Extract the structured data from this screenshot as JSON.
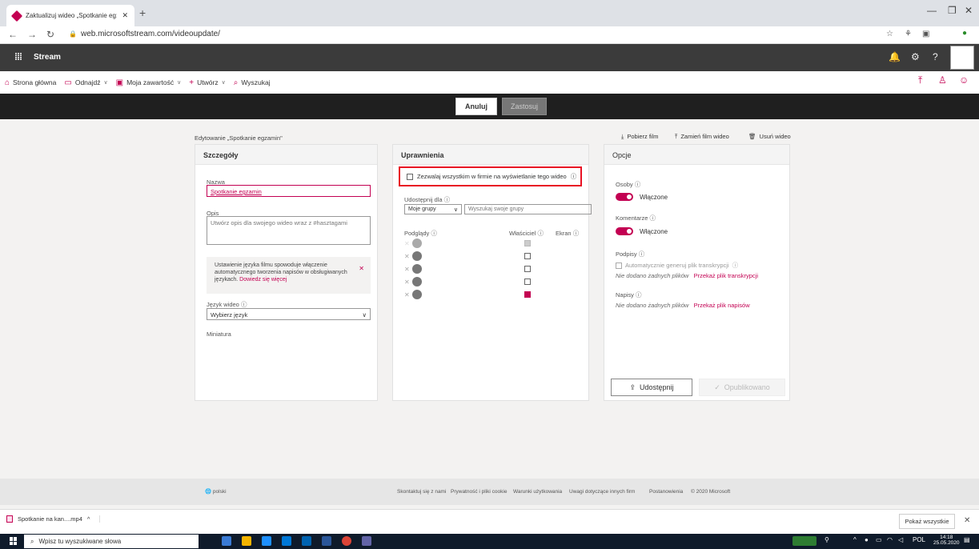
{
  "browser": {
    "tab_title": "Zaktualizuj wideo „Spotkanie eg:",
    "tab_close": "✕",
    "new_tab": "+",
    "url": "web.microsoftstream.com/videoupdate/"
  },
  "header": {
    "brand": "Stream",
    "help": "?"
  },
  "nav": {
    "items": [
      {
        "label": "Strona główna",
        "icon": "home-icon"
      },
      {
        "label": "Odnajdź",
        "icon": "discover-icon"
      },
      {
        "label": "Moja zawartość",
        "icon": "content-icon"
      },
      {
        "label": "Utwórz",
        "icon": "plus-icon"
      },
      {
        "label": "Wyszukaj",
        "icon": "search-icon"
      }
    ]
  },
  "actionbar": {
    "cancel": "Anuluj",
    "apply": "Zastosuj"
  },
  "editing_title": "Edytowanie „Spotkanie egzamin\"",
  "top_actions": {
    "download": "Pobierz film",
    "replace": "Zamień film wideo",
    "delete": "Usuń wideo"
  },
  "details": {
    "title": "Szczegóły",
    "name_label": "Nazwa",
    "name_value": "Spotkanie egzamin",
    "desc_label": "Opis",
    "desc_placeholder": "Utwórz opis dla swojego wideo wraz z #hasztagami",
    "lang_notice": "Ustawienie języka filmu spowoduje włączenie automatycznego tworzenia napisów w obsługiwanych językach.",
    "lang_notice_link": "Dowiedz się więcej",
    "lang_label": "Język wideo",
    "lang_value": "Wybierz język",
    "thumb_label": "Miniatura"
  },
  "permissions": {
    "title": "Uprawnienia",
    "allow_all": "Zezwalaj wszystkim w firmie na wyświetlanie tego wideo",
    "share_label": "Udostępnij dla",
    "share_select": "Moje grupy",
    "share_search_placeholder": "Wyszukaj swoje grupy",
    "col_viewers": "Podglądy",
    "col_owner": "Właściciel",
    "col_screen": "Ekran",
    "rows": [
      {
        "owner": "disabled"
      },
      {
        "owner": "unchecked"
      },
      {
        "owner": "unchecked"
      },
      {
        "owner": "unchecked"
      },
      {
        "owner": "checked"
      }
    ]
  },
  "options": {
    "title": "Opcje",
    "people_label": "Osoby",
    "people_state": "Włączone",
    "comments_label": "Komentarze",
    "comments_state": "Włączone",
    "captions_label": "Podpisy",
    "auto_gen": "Automatycznie generuj plik transkrypcji",
    "no_files_1": "Nie dodano żadnych plików",
    "upload_transcript": "Przekaż plik transkrypcji",
    "subtitles_label": "Napisy",
    "no_files_2": "Nie dodano żadnych plików",
    "upload_subtitles": "Przekaż plik napisów",
    "share_button": "Udostępnij",
    "published_button": "Opublikowano"
  },
  "footer": {
    "language": "polski",
    "links": [
      "Skontaktuj się z nami",
      "Prywatność i pliki cookie",
      "Warunki użytkowania",
      "Uwagi dotyczące innych firm",
      "Postanowienia",
      "© 2020 Microsoft"
    ]
  },
  "downloads": {
    "file": "Spotkanie na kan....mp4",
    "show_all": "Pokaż wszystkie"
  },
  "taskbar": {
    "search_placeholder": "Wpisz tu wyszukiwane słowa",
    "lang": "POL",
    "time": "14:18",
    "date": "25.05.2020"
  },
  "colors": {
    "accent": "#c30052",
    "header_bg": "#3b3b3b",
    "actionbar_bg": "#1f1f1f",
    "highlight_border": "#e81123"
  }
}
